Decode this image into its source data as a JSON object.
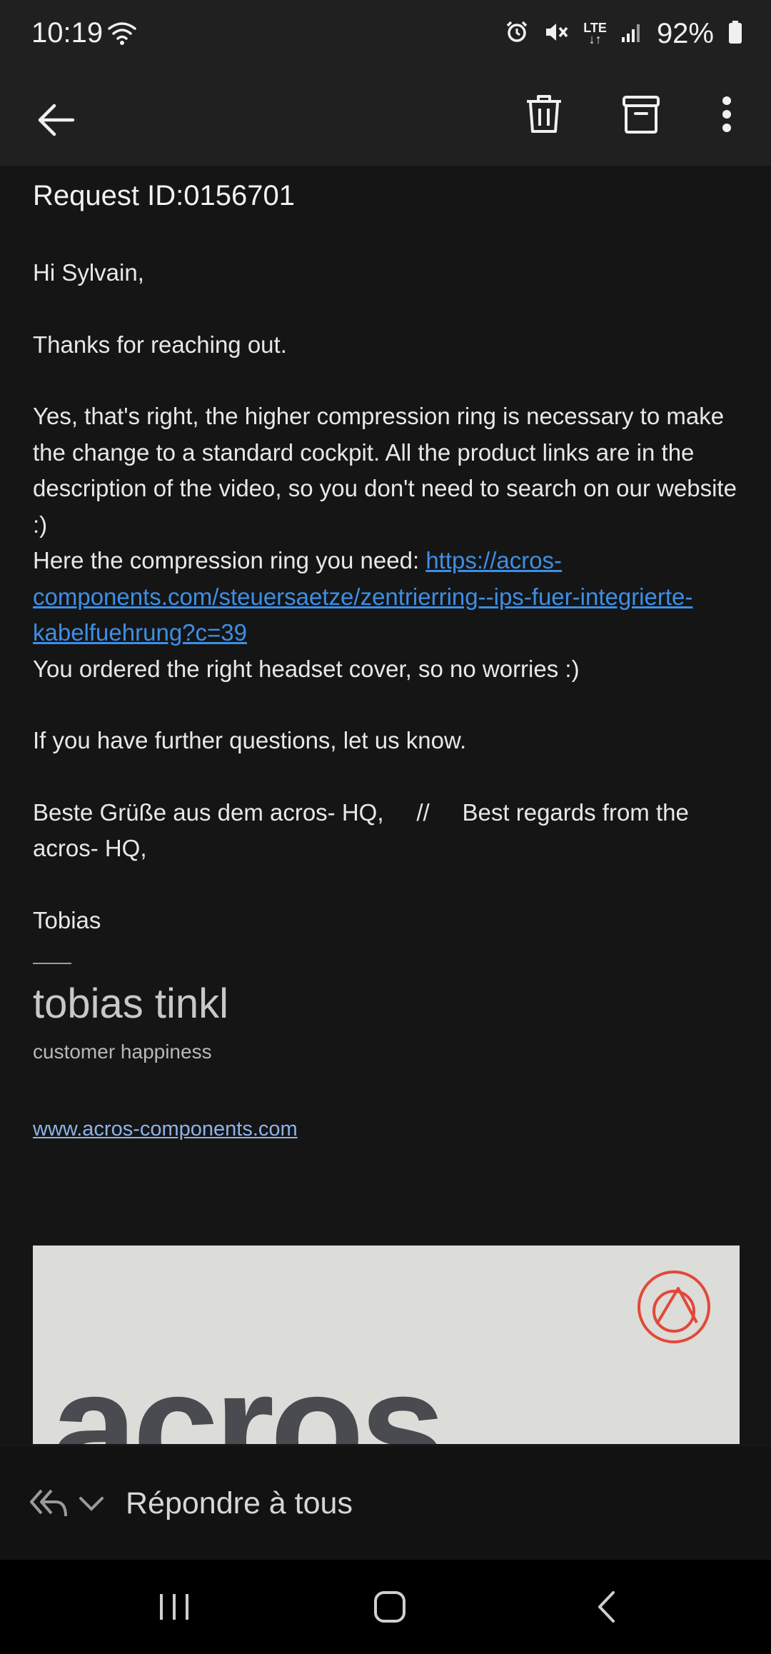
{
  "status_bar": {
    "time": "10:19",
    "battery": "92%",
    "network": "LTE"
  },
  "app_bar": {
    "back_icon": "arrow-left-icon",
    "delete_icon": "trash-icon",
    "archive_icon": "archive-icon",
    "more_icon": "more-vertical-icon"
  },
  "email": {
    "subject": "Request ID:0156701",
    "greeting": "Hi Sylvain,",
    "line1": "Thanks for reaching out.",
    "paragraph": "Yes, that's right, the higher compression ring is necessary to make the change to a standard cockpit. All the product links are in the description of the video, so you don't need to search on our website :)",
    "ring_intro": "Here the compression ring you need: ",
    "ring_link": "https://acros-components.com/steuersaetze/zentrierring--ips-fuer-integrierte-kabelfuehrung?c=39",
    "cover_line": "You ordered the right headset cover, so no worries :)",
    "questions": "If you have further questions, let us know.",
    "regards": "Beste Grüße aus dem acros- HQ,     //     Best regards from the acros- HQ,",
    "signoff": "Tobias",
    "sig_name": "tobias tinkl",
    "sig_role": "customer happiness",
    "sig_site": "www.acros-components.com",
    "banner_text": "acros"
  },
  "bottom": {
    "reply_all_label": "Répondre à tous",
    "reply_icon": "reply-all-icon",
    "chevron_icon": "chevron-down-icon"
  },
  "colors": {
    "background": "#151515",
    "bar": "#202020",
    "link": "#3d8fe6",
    "logo_accent": "#e2483a"
  }
}
